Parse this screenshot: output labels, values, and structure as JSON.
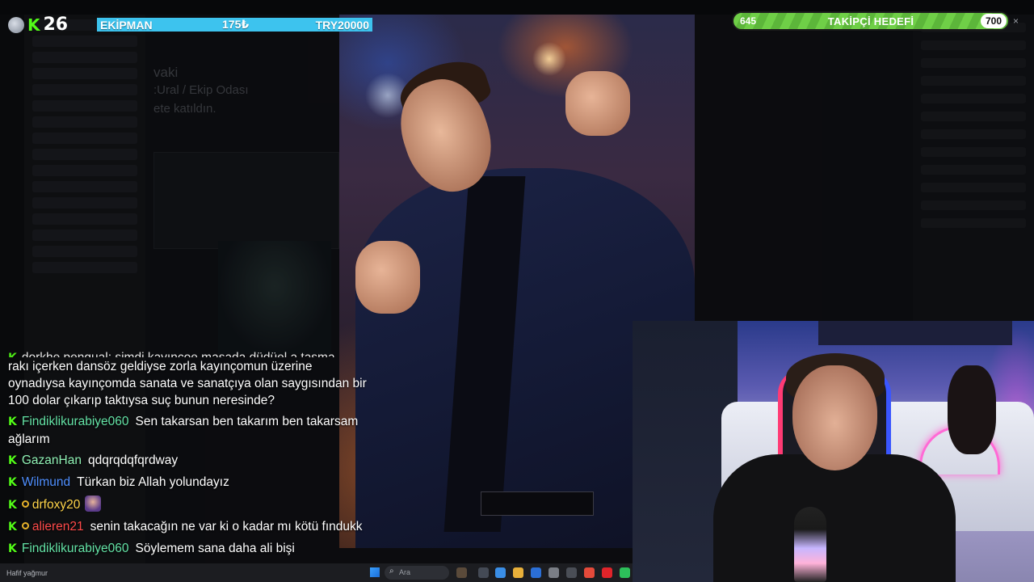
{
  "overlay": {
    "viewer_count": "26",
    "kick_logo": "K",
    "equipment": {
      "label": "EKİPMAN",
      "mid": "175₺",
      "right": "TRY20000"
    },
    "goal": {
      "start": "645",
      "label": "TAKİPÇİ HEDEFİ",
      "end": "700",
      "close": "×"
    }
  },
  "background_app": {
    "text_lines": [
      "vaki",
      ":Ural / Ekip Odası",
      "ete katıldın."
    ]
  },
  "chat": {
    "cut_message": "dorkhe pengual: şimdi kayınçoe masada düdüel a taşma",
    "messages": [
      {
        "user": "",
        "user_color": "#ffffff",
        "text": "rakı içerken dansöz geldiyse zorla kayınçomun üzerine oynadıysa kayınçomda sanata ve sanatçıya olan saygısından bir 100 dolar çıkarıp taktıysa suç bunun neresinde?",
        "continuation": true
      },
      {
        "user": "Findiklikurabiye060",
        "user_color": "#64e3a6",
        "text": "Sen takarsan ben takarım ben takarsam ağlarım"
      },
      {
        "user": "GazanHan",
        "user_color": "#8ff0b4",
        "text": "qdqrqdqfqrdway"
      },
      {
        "user": "Wilmund",
        "user_color": "#4f8fff",
        "text": "Türkan biz Allah yolundayız"
      },
      {
        "user": "drfoxy20",
        "user_color": "#ffd54a",
        "text": "",
        "sub": true,
        "avatar": true
      },
      {
        "user": "alieren21",
        "user_color": "#ff4a4a",
        "text": "senin takacağın ne var ki o kadar mı kötü fındukk",
        "sub": true
      },
      {
        "user": "Findiklikurabiye060",
        "user_color": "#64e3a6",
        "text": "Söylemem sana daha ali bişi"
      }
    ]
  },
  "taskbar": {
    "weather": "Hafif yağmur",
    "search_placeholder": "Ara"
  }
}
